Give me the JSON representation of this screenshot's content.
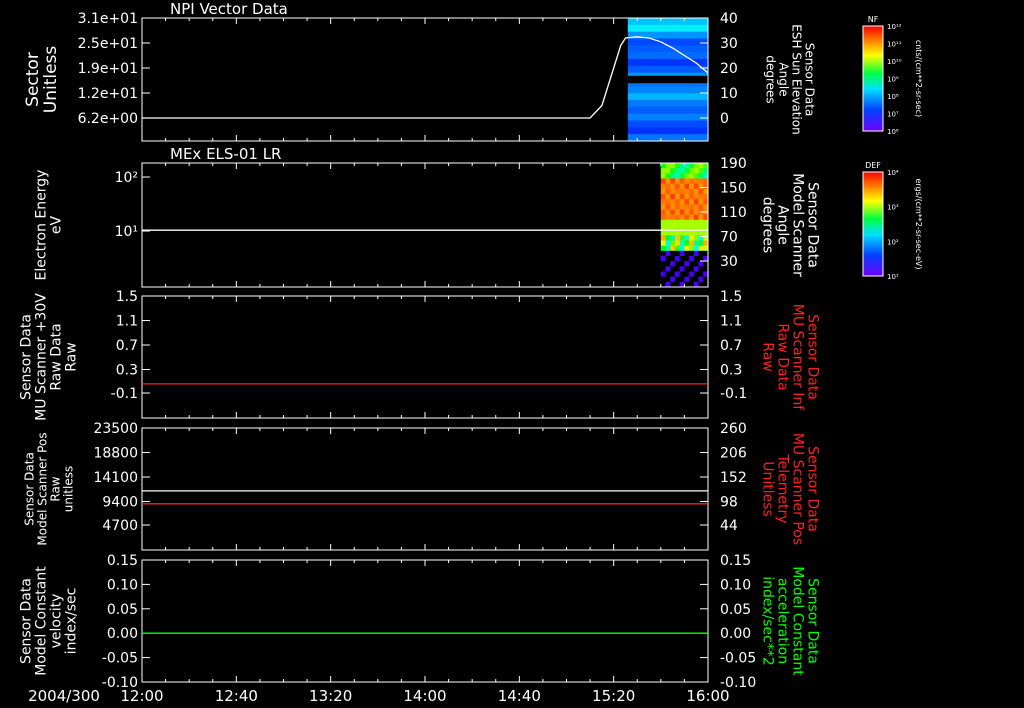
{
  "time_axis": {
    "date_label": "2004/300",
    "ticks": [
      "12:00",
      "12:40",
      "13:20",
      "14:00",
      "14:40",
      "15:20",
      "16:00"
    ],
    "range": [
      "12:00",
      "16:00"
    ]
  },
  "colors": {
    "background": "#000000",
    "axes": "#ffffff",
    "red_trace": "#ff2020",
    "green_trace": "#00ff00"
  },
  "chart_data": [
    {
      "type": "line",
      "title": "NPI Vector Data",
      "left_axis": {
        "label_lines": [
          "Sector",
          "Unitless"
        ],
        "ticks": [
          "3.1e+01",
          "2.5e+01",
          "1.9e+01",
          "1.2e+01",
          "6.2e+00"
        ],
        "range": [
          0,
          31
        ]
      },
      "right_axis": {
        "label_lines": [
          "Sensor Data",
          "ESH Sun Elevation",
          "Angle",
          "degrees"
        ],
        "ticks": [
          "40",
          "30",
          "20",
          "10",
          "0"
        ],
        "range": [
          -8,
          40
        ]
      },
      "series": [
        {
          "axis": "right",
          "color": "#ffffff",
          "x": [
            "12:00",
            "15:00",
            "15:10",
            "15:15",
            "15:20",
            "15:23",
            "15:25",
            "15:30",
            "15:35",
            "15:40",
            "15:45",
            "15:50",
            "15:55",
            "16:00"
          ],
          "y": [
            0,
            0,
            0,
            5,
            20,
            29,
            32,
            32.5,
            32,
            30.5,
            28,
            25,
            22,
            18
          ]
        }
      ],
      "spectrogram": {
        "start": "15:26",
        "end": "16:00",
        "colorbar": {
          "label": "NF",
          "units": "cnts/(cm**2-sr-sec)",
          "ticks": [
            "10¹²",
            "10¹¹",
            "10¹⁰",
            "10⁹",
            "10⁸",
            "10⁷",
            "10⁶"
          ]
        }
      }
    },
    {
      "type": "heatmap",
      "title": "MEx ELS-01 LR",
      "left_axis": {
        "label_lines": [
          "Electron Energy",
          "eV"
        ],
        "ticks": [
          "10²",
          "10¹"
        ],
        "scale": "log"
      },
      "right_axis": {
        "label_lines": [
          "Sensor Data",
          "Model Scanner",
          "Angle",
          "degrees"
        ],
        "ticks": [
          "190",
          "150",
          "110",
          "70",
          "30"
        ],
        "range": [
          0,
          190
        ]
      },
      "series": [
        {
          "axis": "right",
          "color": "#ffffff",
          "x": [
            "12:00",
            "16:00"
          ],
          "y": [
            87,
            87
          ]
        }
      ],
      "spectrogram": {
        "start": "15:40",
        "end": "16:00",
        "colorbar": {
          "label": "DEF",
          "units": "ergs/(cm**2-sr-sec-eV)",
          "ticks": [
            "10⁴",
            "10³",
            "10²",
            "10¹"
          ]
        }
      }
    },
    {
      "type": "line",
      "left_axis": {
        "label_lines": [
          "Sensor Data",
          "MU Scanner +30V",
          "Raw Data",
          "Raw"
        ],
        "ticks": [
          "1.5",
          "1.1",
          "0.7",
          "0.3",
          "-0.1"
        ],
        "range": [
          -0.3,
          1.5
        ]
      },
      "right_axis": {
        "label_lines": [
          "Sensor Data",
          "MU Scanner Inf",
          "Raw Data",
          "Raw"
        ],
        "ticks": [
          "1.5",
          "1.1",
          "0.7",
          "0.3",
          "-0.1"
        ],
        "range": [
          -0.3,
          1.5
        ],
        "color": "#ff2020"
      },
      "series": [
        {
          "axis": "right",
          "color": "#ff2020",
          "x": [
            "12:00",
            "16:00"
          ],
          "y": [
            0.05,
            0.05
          ]
        }
      ]
    },
    {
      "type": "line",
      "left_axis": {
        "label_lines": [
          "Sensor Data",
          "Model Scanner Pos",
          "Raw",
          "unitless"
        ],
        "ticks": [
          "23500",
          "18800",
          "14100",
          "9400",
          "4700"
        ],
        "range": [
          0,
          23500
        ]
      },
      "right_axis": {
        "label_lines": [
          "Sensor Data",
          "MU Scanner Pos",
          "Telemetry",
          "Unitless"
        ],
        "ticks": [
          "260",
          "206",
          "152",
          "98",
          "44"
        ],
        "range": [
          -10,
          260
        ],
        "color": "#ff2020"
      },
      "series": [
        {
          "axis": "left",
          "color": "#ffffff",
          "x": [
            "12:00",
            "16:00"
          ],
          "y": [
            11300,
            11300
          ]
        },
        {
          "axis": "left",
          "color": "#ff2020",
          "x": [
            "12:00",
            "16:00"
          ],
          "y": [
            8800,
            8800
          ]
        }
      ]
    },
    {
      "type": "line",
      "left_axis": {
        "label_lines": [
          "Sensor Data",
          "Model Constant",
          "velocity",
          "index/sec"
        ],
        "ticks": [
          "0.15",
          "0.10",
          "0.05",
          "0.00",
          "-0.05",
          "-0.10"
        ],
        "range": [
          -0.1,
          0.15
        ]
      },
      "right_axis": {
        "label_lines": [
          "Sensor Data",
          "Model Constant",
          "acceleration",
          "index/sec**2"
        ],
        "ticks": [
          "0.15",
          "0.10",
          "0.05",
          "0.00",
          "-0.05",
          "-0.10"
        ],
        "range": [
          -0.1,
          0.15
        ],
        "color": "#00ff00"
      },
      "series": [
        {
          "axis": "right",
          "color": "#00ff00",
          "x": [
            "12:00",
            "16:00"
          ],
          "y": [
            0.0,
            0.0
          ]
        }
      ]
    }
  ]
}
